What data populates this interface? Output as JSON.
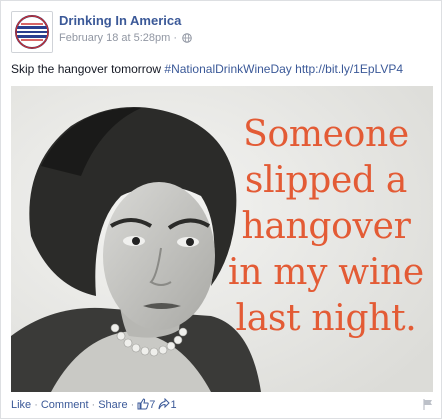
{
  "post": {
    "page_name": "Drinking In America",
    "timestamp": "February 18 at 5:28pm",
    "meta_separator": "·",
    "status_text": "Skip the hangover tomorrow",
    "hashtag": "#NationalDrinkWineDay",
    "link": "http://bit.ly/1EpLVP4",
    "avatar_icon": "drinking-in-america-logo",
    "privacy_icon": "globe-icon"
  },
  "image": {
    "caption_lines": [
      "Someone",
      "slipped a",
      "hangover",
      "in my wine",
      "last night."
    ],
    "caption_color": "#e35b35",
    "background_color": "#ebebe8"
  },
  "actions": {
    "like": "Like",
    "comment": "Comment",
    "share": "Share",
    "separator": "·",
    "likes_count": "7",
    "shares_count": "1",
    "likes_icon": "thumbs-up-icon",
    "shares_icon": "share-arrow-icon",
    "report_icon": "flag-icon"
  },
  "colors": {
    "link": "#3b5998",
    "meta": "#9197a3",
    "text": "#141823"
  }
}
